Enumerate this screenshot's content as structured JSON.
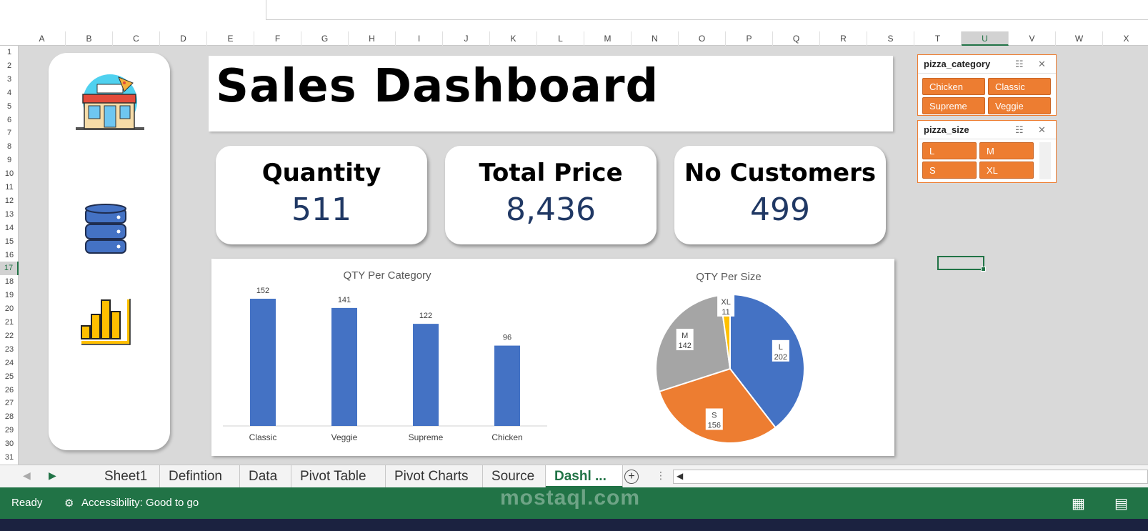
{
  "columns": [
    "A",
    "B",
    "C",
    "D",
    "E",
    "F",
    "G",
    "H",
    "I",
    "J",
    "K",
    "L",
    "M",
    "N",
    "O",
    "P",
    "Q",
    "R",
    "S",
    "T",
    "U",
    "V",
    "W",
    "X"
  ],
  "selected_column": "U",
  "rows": [
    "1",
    "2",
    "3",
    "4",
    "5",
    "6",
    "7",
    "8",
    "9",
    "10",
    "11",
    "12",
    "13",
    "14",
    "15",
    "16",
    "17",
    "18",
    "19",
    "20",
    "21",
    "22",
    "23",
    "24",
    "25",
    "26",
    "27",
    "28",
    "29",
    "30",
    "31"
  ],
  "selected_row": "17",
  "dashboard": {
    "title": "Sales Dashboard",
    "kpis": [
      {
        "label": "Quantity",
        "value": "511"
      },
      {
        "label": "Total Price",
        "value": "8,436"
      },
      {
        "label": "No Customers",
        "value": "499"
      }
    ],
    "sidebar_icons": [
      "pizza-shop-icon",
      "database-icon",
      "bar-chart-icon"
    ]
  },
  "chart_data": [
    {
      "type": "bar",
      "title": "QTY Per Category",
      "categories": [
        "Classic",
        "Veggie",
        "Supreme",
        "Chicken"
      ],
      "values": [
        152,
        141,
        122,
        96
      ],
      "color": "#4472c4",
      "ylim": [
        0,
        152
      ]
    },
    {
      "type": "pie",
      "title": "QTY Per Size",
      "categories": [
        "L",
        "S",
        "M",
        "XL"
      ],
      "values": [
        202,
        156,
        142,
        11
      ],
      "colors": [
        "#4472c4",
        "#ed7d31",
        "#a5a5a5",
        "#ffc000"
      ]
    }
  ],
  "slicers": [
    {
      "title": "pizza_category",
      "items": [
        "Chicken",
        "Classic",
        "Supreme",
        "Veggie"
      ]
    },
    {
      "title": "pizza_size",
      "items": [
        "L",
        "M",
        "S",
        "XL"
      ]
    }
  ],
  "sheet_tabs": [
    "Sheet1",
    "Defintion",
    "Data",
    "Pivot Table",
    "Pivot Charts",
    "Source",
    "Dashl ..."
  ],
  "active_tab": "Dashl ...",
  "status": {
    "ready": "Ready",
    "accessibility": "Accessibility: Good to go"
  },
  "watermark": "mostaql.com",
  "colors": {
    "excel_green": "#217346",
    "accent_orange": "#ed7d31",
    "kpi_value": "#203864"
  }
}
